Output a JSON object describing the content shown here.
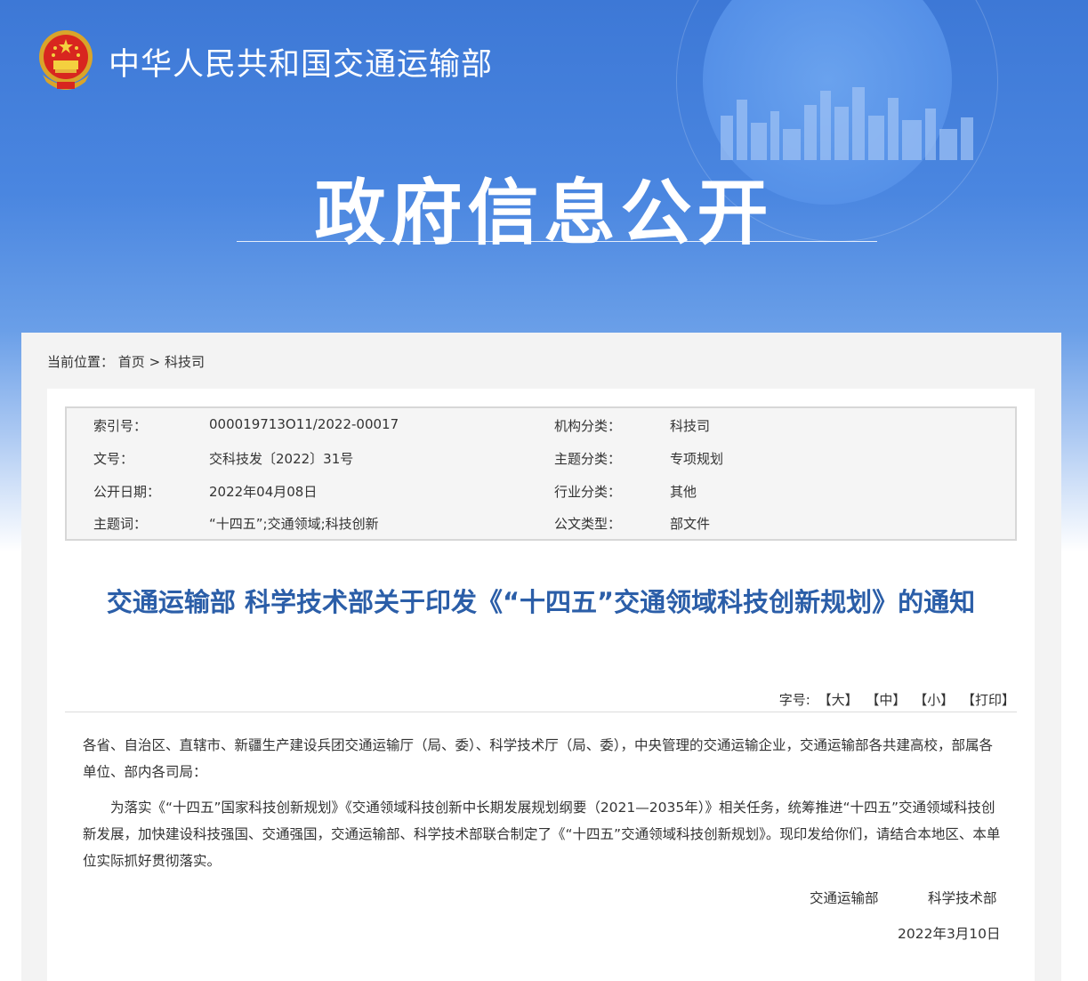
{
  "header": {
    "site_title": "中华人民共和国交通运输部",
    "section_title": "政府信息公开",
    "emblem_icon": "national-emblem-icon"
  },
  "breadcrumb": {
    "label": "当前位置：",
    "items": [
      "首页",
      "科技司"
    ],
    "separator": ">"
  },
  "meta": {
    "index_label": "索引号：",
    "index_value": "000019713O11/2022-00017",
    "org_label": "机构分类：",
    "org_value": "科技司",
    "docno_label": "文号：",
    "docno_value": "交科技发〔2022〕31号",
    "topic_label": "主题分类：",
    "topic_value": "专项规划",
    "date_label": "公开日期：",
    "date_value": "2022年04月08日",
    "industry_label": "行业分类：",
    "industry_value": "其他",
    "keyword_label": "主题词：",
    "keyword_value": "“十四五”;交通领域;科技创新",
    "doctype_label": "公文类型：",
    "doctype_value": "部文件"
  },
  "document": {
    "title": "交通运输部 科学技术部关于印发《“十四五”交通领域科技创新规划》的通知",
    "font_size_label": "字号:",
    "size_large": "【大】",
    "size_medium": "【中】",
    "size_small": "【小】",
    "print": "【打印】",
    "recipients": "各省、自治区、直辖市、新疆生产建设兵团交通运输厅（局、委）、科学技术厅（局、委），中央管理的交通运输企业，交通运输部各共建高校，部属各单位、部内各司局：",
    "paragraph": "为落实《“十四五”国家科技创新规划》《交通领域科技创新中长期发展规划纲要（2021—2035年）》相关任务，统筹推进“十四五”交通领域科技创新发展，加快建设科技强国、交通强国，交通运输部、科学技术部联合制定了《“十四五”交通领域科技创新规划》。现印发给你们，请结合本地区、本单位实际抓好贯彻落实。",
    "signer1": "交通运输部",
    "signer2": "科学技术部",
    "sign_date": "2022年3月10日"
  },
  "colors": {
    "banner_blue": "#3d78d6",
    "title_blue": "#2b5ea8"
  }
}
